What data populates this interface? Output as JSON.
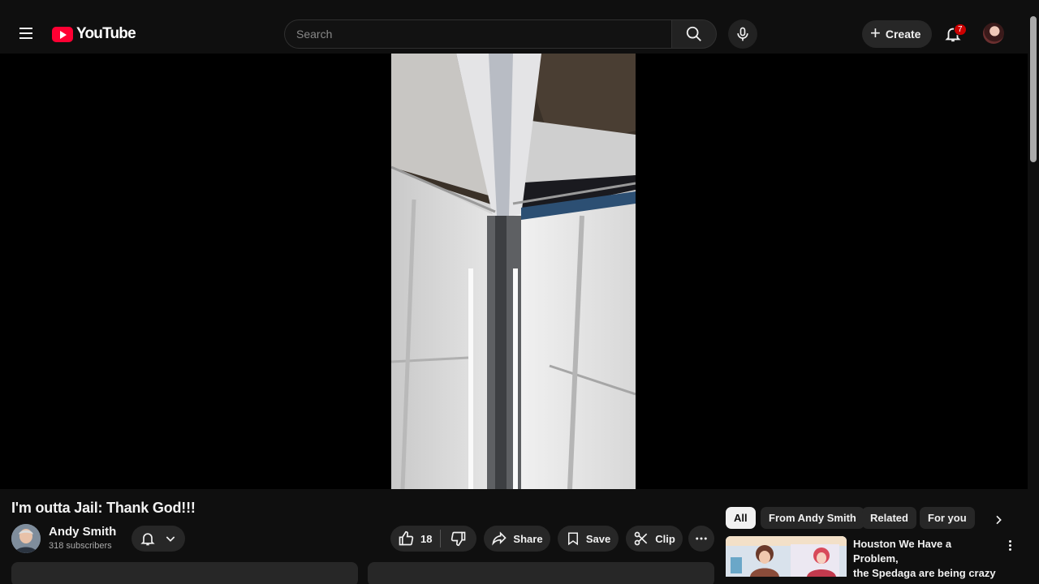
{
  "header": {
    "logo_text": "YouTube",
    "search_placeholder": "Search",
    "create_label": "Create",
    "notification_count": "7"
  },
  "video": {
    "title": "I'm outta Jail: Thank God!!!",
    "channel_name": "Andy Smith",
    "subscribers": "318 subscribers",
    "likes": "18"
  },
  "actions": {
    "share": "Share",
    "save": "Save",
    "clip": "Clip"
  },
  "chips": [
    "All",
    "From Andy Smith",
    "Related",
    "For you"
  ],
  "recommendation": {
    "title_line1": "Houston We Have a Problem,",
    "title_line2": "the Spedaga are being crazy ..."
  },
  "colors": {
    "background": "#0f0f0f",
    "brand_red": "#ff0033",
    "chip_bg": "#272727",
    "badge_red": "#cc0000"
  },
  "icons": [
    "menu-icon",
    "youtube-logo-icon",
    "search-icon",
    "mic-icon",
    "plus-icon",
    "bell-icon",
    "thumbs-up-icon",
    "thumbs-down-icon",
    "share-icon",
    "bookmark-icon",
    "scissors-icon",
    "more-horizontal-icon",
    "chevron-right-icon",
    "chevron-down-icon",
    "more-vertical-icon"
  ]
}
